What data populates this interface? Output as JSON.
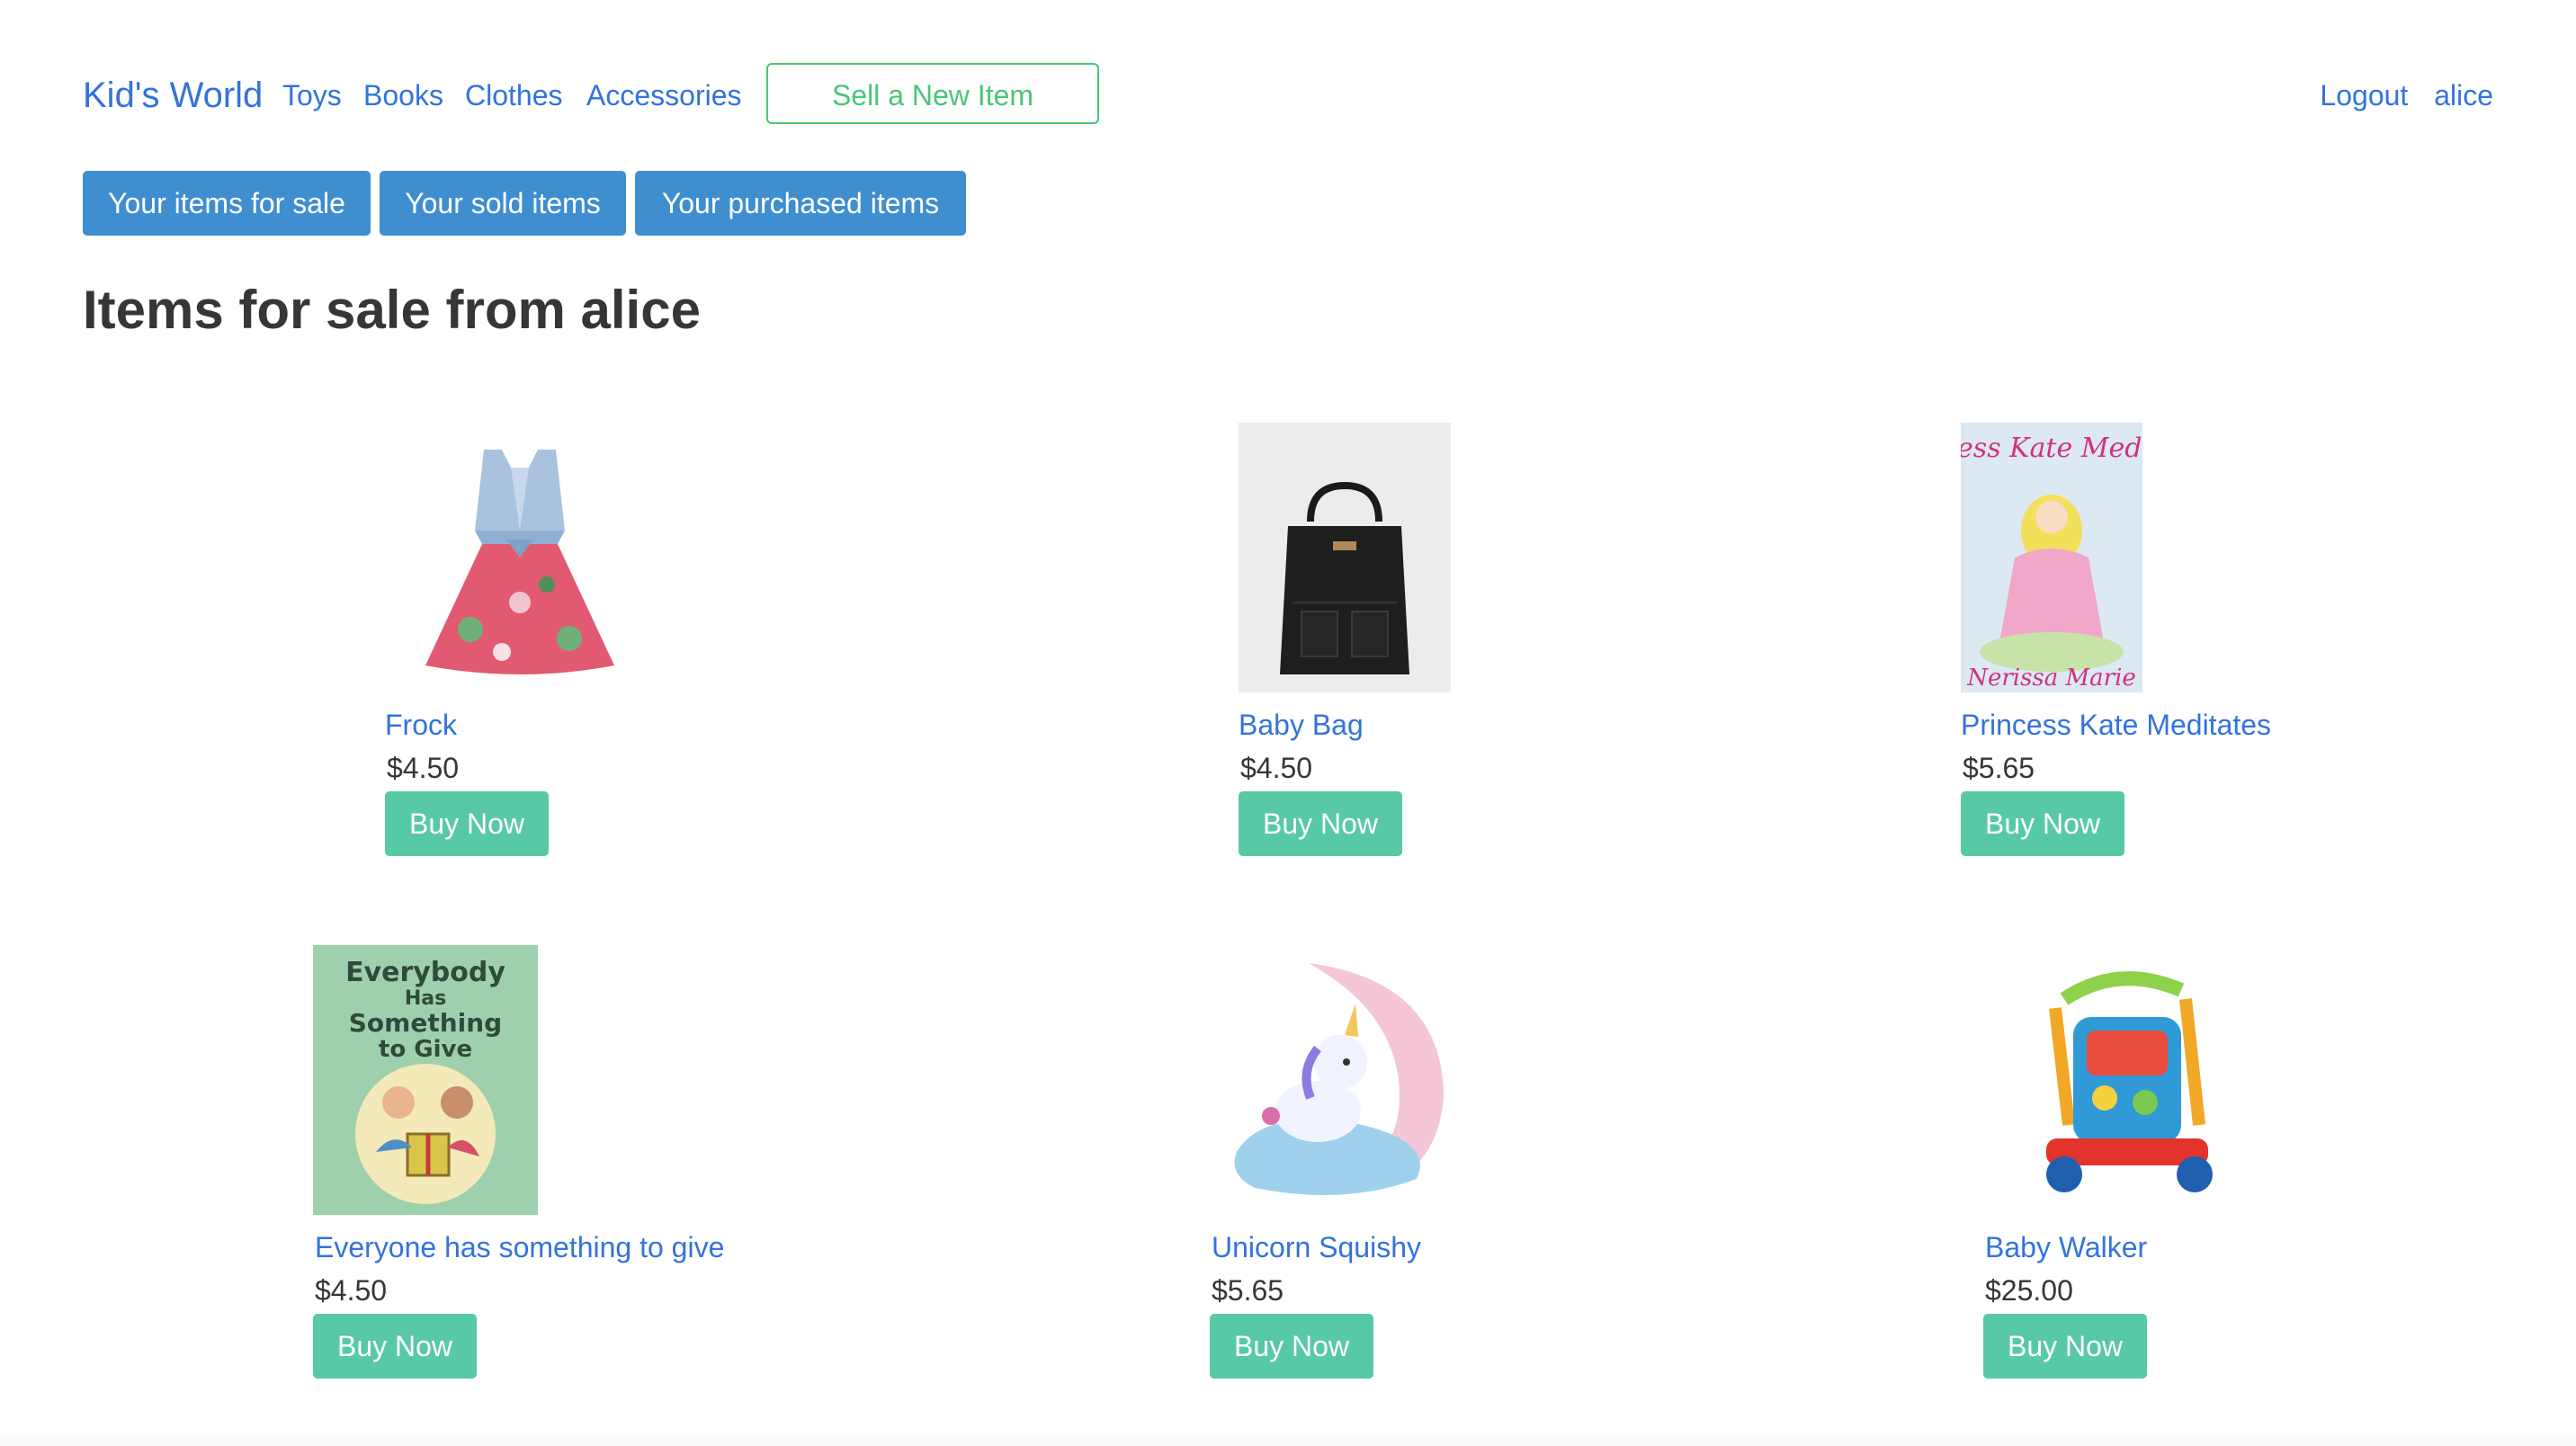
{
  "navbar": {
    "brand": "Kid's World",
    "links": [
      "Toys",
      "Books",
      "Clothes",
      "Accessories"
    ],
    "sell_button": "Sell a New Item",
    "logout": "Logout",
    "username": "alice"
  },
  "tabs": [
    "Your items for sale",
    "Your sold items",
    "Your purchased items"
  ],
  "page_title": "Items for sale from alice",
  "items": [
    {
      "name": "Frock",
      "price": "$4.50",
      "button": "Buy Now",
      "image": "frock-image"
    },
    {
      "name": "Baby Bag",
      "price": "$4.50",
      "button": "Buy Now",
      "image": "baby-bag-image"
    },
    {
      "name": "Princess Kate Meditates",
      "price": "$5.65",
      "button": "Buy Now",
      "image": "book-cover-image",
      "cover_title": "Princess Kate Meditates",
      "cover_author": "Nerissa Marie"
    },
    {
      "name": "Everyone has something to give",
      "price": "$4.50",
      "button": "Buy Now",
      "image": "book-cover-image",
      "cover_title_lines": [
        "Everybody",
        "Has",
        "Something",
        "to Give"
      ]
    },
    {
      "name": "Unicorn Squishy",
      "price": "$5.65",
      "button": "Buy Now",
      "image": "unicorn-squishy-image"
    },
    {
      "name": "Baby Walker",
      "price": "$25.00",
      "button": "Buy Now",
      "image": "baby-walker-image"
    }
  ],
  "colors": {
    "link": "#3273dc",
    "tab_bg": "#3e8ed0",
    "buy_bg": "#58c9a7",
    "sell_border": "#48c774"
  }
}
